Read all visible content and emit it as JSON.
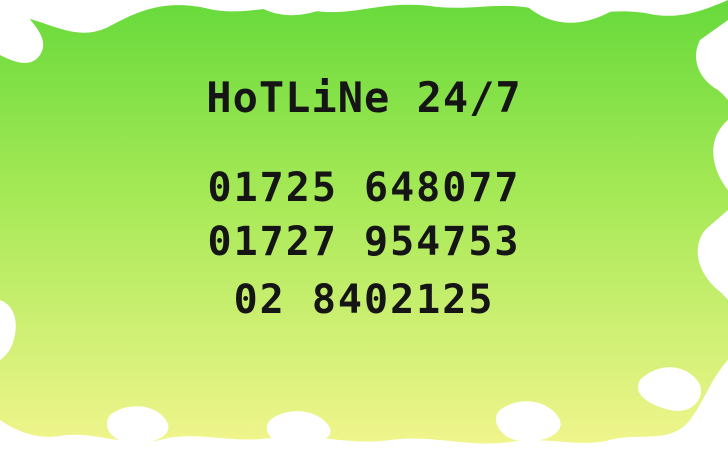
{
  "hotline": {
    "title": "HoTLiNe 24/7",
    "numbers": [
      "01725 648077",
      "01727 954753",
      "02 8402125"
    ]
  },
  "colors": {
    "green_top": "#6fdc3e",
    "green_mid": "#a8ea55",
    "yellow_bottom": "#eef58a",
    "text": "#151515"
  }
}
